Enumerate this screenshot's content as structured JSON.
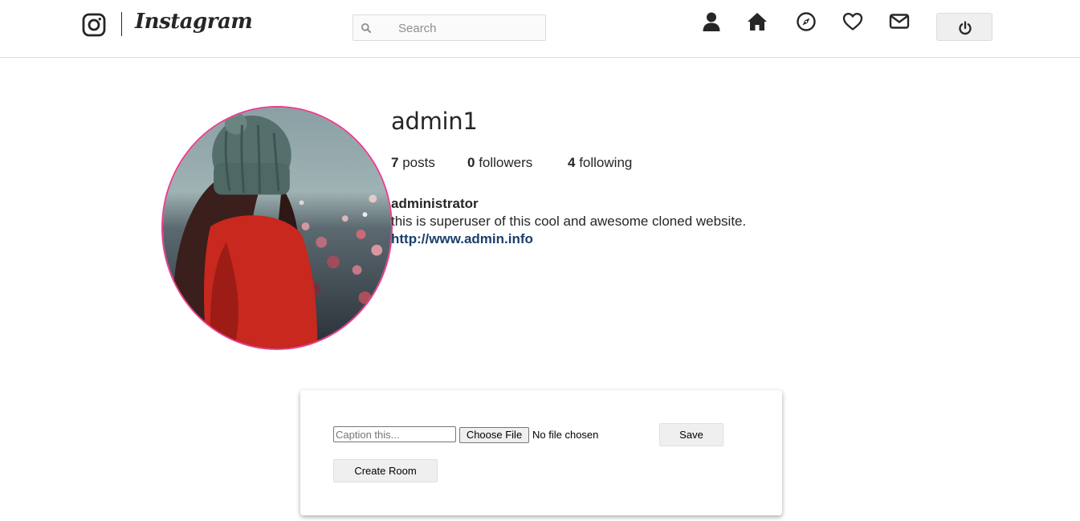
{
  "header": {
    "logo_text": "Instagram",
    "search_placeholder": "Search",
    "nav_icons": [
      "profile-icon",
      "home-icon",
      "explore-icon",
      "heart-icon",
      "mail-icon"
    ],
    "power_icon": "power-icon"
  },
  "profile": {
    "username": "admin1",
    "stats": {
      "posts_count": "7",
      "posts_label": "posts",
      "followers_count": "0",
      "followers_label": "followers",
      "following_count": "4",
      "following_label": "following"
    },
    "full_name": "administrator",
    "bio": "this is superuser of this cool and awesome cloned website.",
    "website": "http://www.admin.info",
    "avatar_border_color": "#e83e8c"
  },
  "upload": {
    "caption_placeholder": "Caption this...",
    "choose_file_label": "Choose File",
    "file_status": "No file chosen",
    "save_label": "Save",
    "create_room_label": "Create Room"
  }
}
